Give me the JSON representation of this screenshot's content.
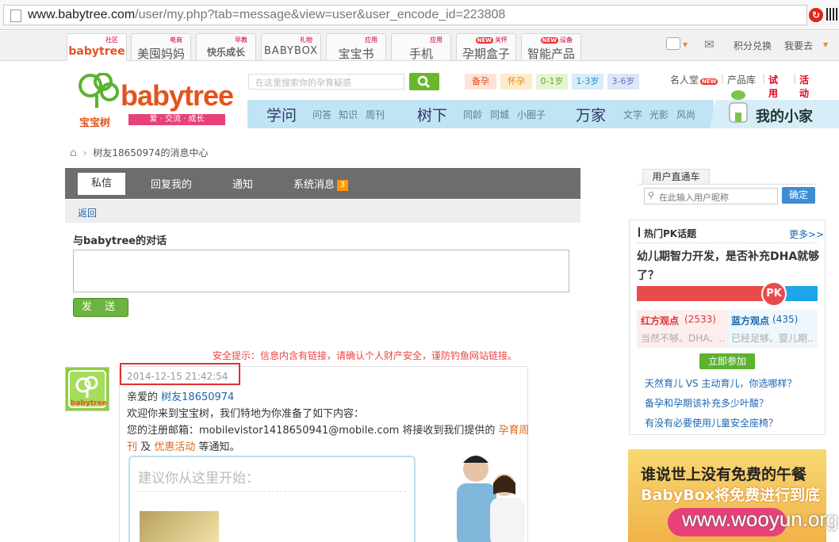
{
  "browser": {
    "url_host": "www.babytree.com",
    "url_path": "/user/my.php?tab=message&view=user&user_encode_id=223808"
  },
  "site_tabs": [
    {
      "small": "社区",
      "label": "babytree"
    },
    {
      "small": "电商",
      "label": "美囤妈妈"
    },
    {
      "small": "早教",
      "label": "快乐成长"
    },
    {
      "small": "礼物",
      "label": "BABYBOX"
    },
    {
      "small": "应用",
      "label": "宝宝书"
    },
    {
      "small": "应用",
      "label": "手机"
    },
    {
      "small": "关怀",
      "label": "孕期盒子"
    },
    {
      "small": "设备",
      "label": "智能产品"
    }
  ],
  "top_right": {
    "points": "积分兑换",
    "go": "我要去"
  },
  "header": {
    "logo_text": "babytree",
    "logo_cn": "宝宝树",
    "slogan": "爱 · 交流 · 成长",
    "search_placeholder": "在这里搜索你的孕育疑惑",
    "stages": [
      {
        "label": "备孕",
        "color": "#e4531d",
        "bg": "#fde3d8"
      },
      {
        "label": "怀孕",
        "color": "#e88a1a",
        "bg": "#fdeccc"
      },
      {
        "label": "0-1岁",
        "color": "#6aa82a",
        "bg": "#e6f4d4"
      },
      {
        "label": "1-3岁",
        "color": "#2a90c6",
        "bg": "#d7edf8"
      },
      {
        "label": "3-6岁",
        "color": "#5a78c6",
        "bg": "#e0e6f8"
      }
    ],
    "links": {
      "famous": "名人堂",
      "products": "产品库",
      "trial": "试用",
      "activity": "活动"
    },
    "nav": {
      "study": "学问",
      "study_sub": [
        "问答",
        "知识",
        "周刊"
      ],
      "tree": "树下",
      "tree_sub": [
        "同龄",
        "同城",
        "小圈子"
      ],
      "home": "万家",
      "home_sub": [
        "文字",
        "光影",
        "风尚"
      ],
      "myhome": "我的小家"
    }
  },
  "breadcrumb": {
    "text": "树友18650974的消息中心"
  },
  "message_tabs": {
    "private": "私信",
    "reply": "回复我的",
    "notice": "通知",
    "system": "系统消息",
    "system_count": "3"
  },
  "back": "返回",
  "conversation": {
    "title": "与babytree的对话",
    "send": "发 送",
    "safety": "安全提示：信息内含有链接，请确认个人财产安全，谨防钓鱼网站链接。",
    "timestamp": "2014-12-15 21:42:54",
    "greeting_prefix": "亲爱的",
    "user_link": "树友18650974",
    "line2": "欢迎你来到宝宝树，我们特地为你准备了如下内容：",
    "line3_prefix": "您的注册邮箱：mobilevistor1418650941@mobile.com 将接收到我们提供的",
    "weekly_link_a": "孕育周",
    "weekly_link_b": "刊",
    "and": "及",
    "promo_link": "优惠活动",
    "suffix": "等通知。",
    "suggest": "建议你从这里开始："
  },
  "user_direct": {
    "title": "用户直通车",
    "placeholder": "在此输入用户昵称",
    "confirm": "确定"
  },
  "pk": {
    "title": "热门PK话题",
    "more": "更多>>",
    "question": "幼儿期智力开发，是否补充DHA就够了？",
    "badge": "PK",
    "red_label": "红方观点",
    "red_count": "(2533)",
    "red_text": "当然不够。DHA、...",
    "blue_label": "蓝方观点",
    "blue_count": "(435)",
    "blue_text": "已经足够。婴儿期...",
    "join": "立即参加",
    "links": [
      "天然育儿 VS 主动育儿，你选哪样？",
      "备孕和孕期该补充多少叶酸？",
      "有没有必要使用儿童安全座椅？"
    ]
  },
  "ad": {
    "line1": "谁说世上没有免费的午餐",
    "line2": "BabyBox将免费进行到底"
  },
  "watermark": "www.wooyun.org"
}
